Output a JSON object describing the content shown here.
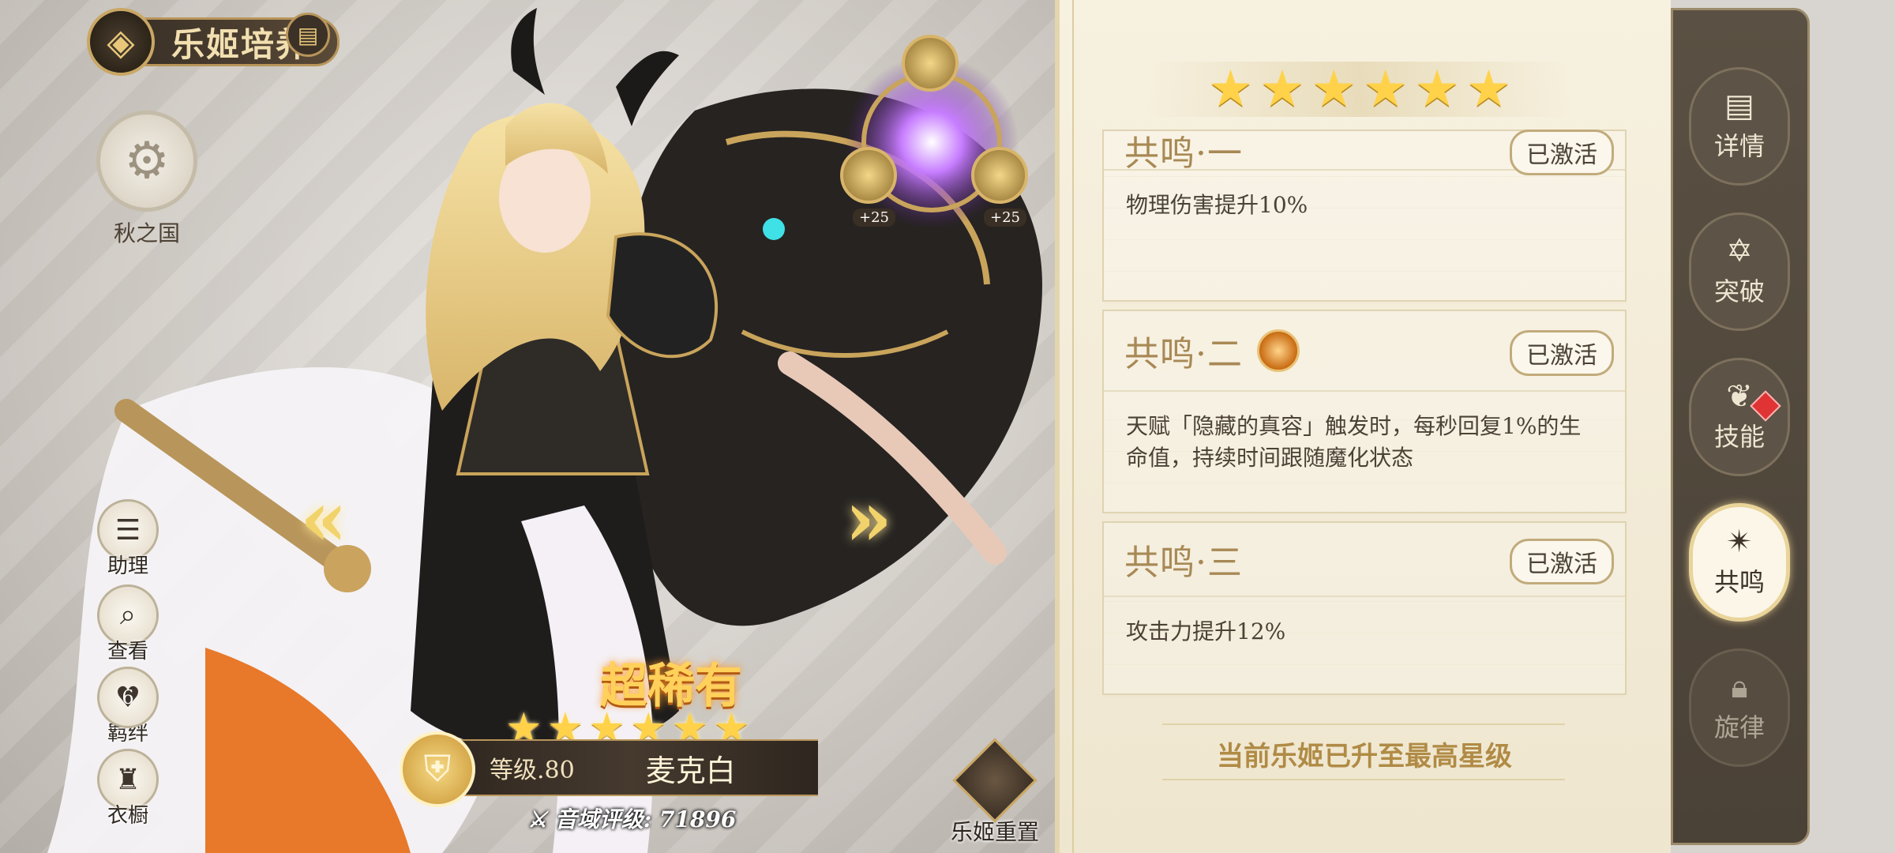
{
  "header": {
    "title": "乐姬培养"
  },
  "faction": {
    "label": "秋之国"
  },
  "side_buttons": [
    {
      "label": "助理",
      "icon": "assistant-icon"
    },
    {
      "label": "查看",
      "icon": "magnifier-icon"
    },
    {
      "label": "羁绊",
      "icon": "heart-icon",
      "badge": "6"
    },
    {
      "label": "衣橱",
      "icon": "wardrobe-icon"
    }
  ],
  "gem_bonus": [
    "+25",
    "+25"
  ],
  "character": {
    "rarity": "超稀有",
    "stars": 6,
    "level": "等级.80",
    "name": "麦克白",
    "power_label": "音域评级: 71896"
  },
  "reset": {
    "label": "乐姬重置"
  },
  "panel": {
    "stars": 6,
    "resonances": [
      {
        "title": "共鸣·一",
        "status": "已激活",
        "desc": "物理伤害提升10%",
        "has_gem": false
      },
      {
        "title": "共鸣·二",
        "status": "已激活",
        "desc": "天赋「隐藏的真容」触发时，每秒回复1%的生命值，持续时间跟随魔化状态",
        "has_gem": true
      },
      {
        "title": "共鸣·三",
        "status": "已激活",
        "desc": "攻击力提升12%",
        "has_gem": false
      }
    ],
    "max_level_text": "当前乐姬已升至最高星级"
  },
  "tabs": [
    {
      "label": "详情",
      "icon": "scroll-icon",
      "active": false
    },
    {
      "label": "突破",
      "icon": "star-emblem-icon",
      "active": false
    },
    {
      "label": "技能",
      "icon": "wings-icon",
      "active": false,
      "notify": true
    },
    {
      "label": "共鸣",
      "icon": "resonance-icon",
      "active": true
    },
    {
      "label": "旋律",
      "icon": "lock-icon",
      "active": false,
      "locked": true
    }
  ],
  "colors": {
    "gold": "#ffd24a",
    "panel_bg": "#f7f1e0",
    "accent_brown": "#a88955",
    "notify_red": "#e03434"
  }
}
